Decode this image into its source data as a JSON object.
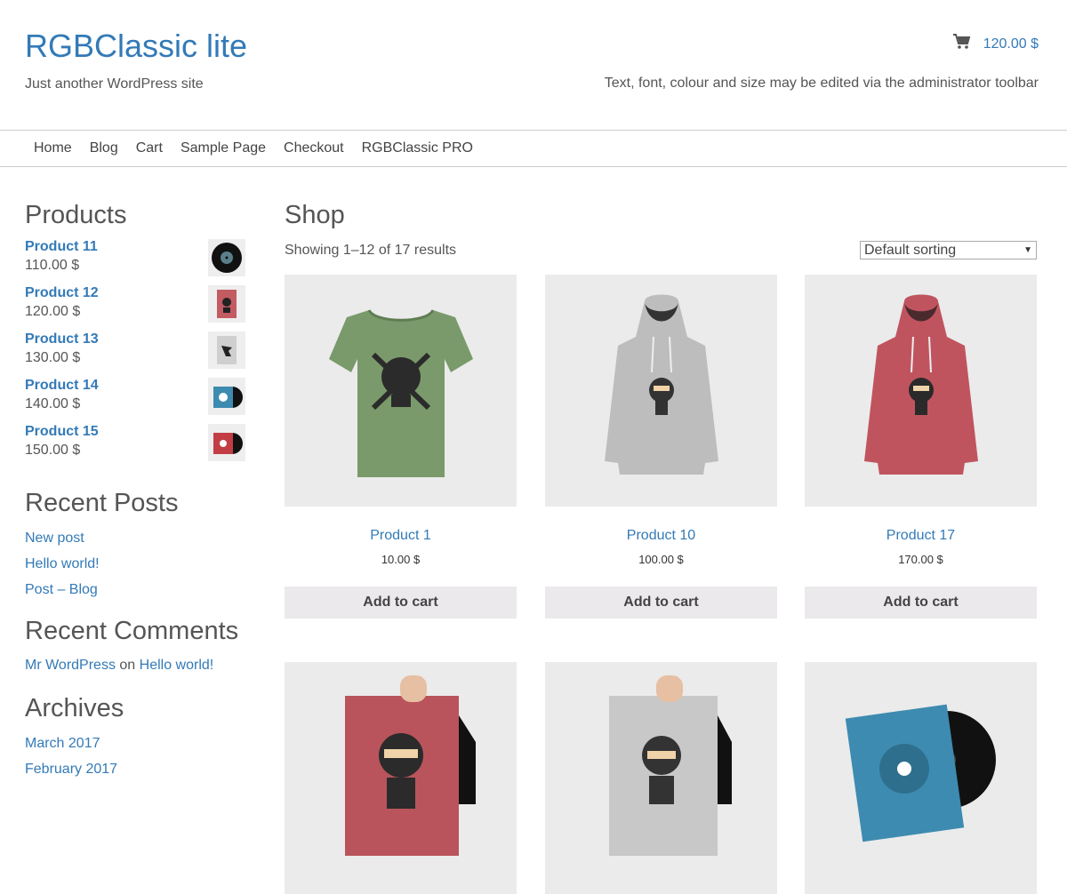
{
  "site": {
    "title": "RGBClassic lite",
    "description": "Just another WordPress site",
    "cart_total": "120.00 $",
    "header_note": "Text, font, colour and size may be edited via the administrator toolbar"
  },
  "nav": {
    "items": [
      "Home",
      "Blog",
      "Cart",
      "Sample Page",
      "Checkout",
      "RGBClassic PRO"
    ]
  },
  "sidebar": {
    "products_title": "Products",
    "products": [
      {
        "name": "Product 11",
        "price": "110.00 $",
        "thumb": "vinyl-record-icon"
      },
      {
        "name": "Product 12",
        "price": "120.00 $",
        "thumb": "red-poster-icon"
      },
      {
        "name": "Product 13",
        "price": "130.00 $",
        "thumb": "grey-poster-icon"
      },
      {
        "name": "Product 14",
        "price": "140.00 $",
        "thumb": "blue-album-icon"
      },
      {
        "name": "Product 15",
        "price": "150.00 $",
        "thumb": "red-album-icon"
      }
    ],
    "recent_posts_title": "Recent Posts",
    "recent_posts": [
      "New post",
      "Hello world!",
      "Post – Blog"
    ],
    "recent_comments_title": "Recent Comments",
    "recent_comment": {
      "author": "Mr WordPress",
      "on": "on",
      "post": "Hello world!"
    },
    "archives_title": "Archives",
    "archives": [
      "March 2017",
      "February 2017"
    ]
  },
  "main": {
    "title": "Shop",
    "result_count": "Showing 1–12 of 17 results",
    "sort_selected": "Default sorting",
    "products": [
      {
        "name": "Product 1",
        "price": "10.00 $",
        "button": "Add to cart",
        "image": "green-tshirt"
      },
      {
        "name": "Product 10",
        "price": "100.00 $",
        "button": "Add to cart",
        "image": "grey-hoodie"
      },
      {
        "name": "Product 17",
        "price": "170.00 $",
        "button": "Add to cart",
        "image": "red-hoodie"
      },
      {
        "name": "",
        "price": "",
        "button": "",
        "image": "red-ninja-poster"
      },
      {
        "name": "",
        "price": "",
        "button": "",
        "image": "grey-ninja-poster"
      },
      {
        "name": "",
        "price": "",
        "button": "",
        "image": "blue-vinyl-album"
      }
    ]
  },
  "colors": {
    "link": "#337ab7",
    "text": "#555555",
    "button_bg": "#ebe9eb",
    "image_bg": "#ebebeb"
  }
}
